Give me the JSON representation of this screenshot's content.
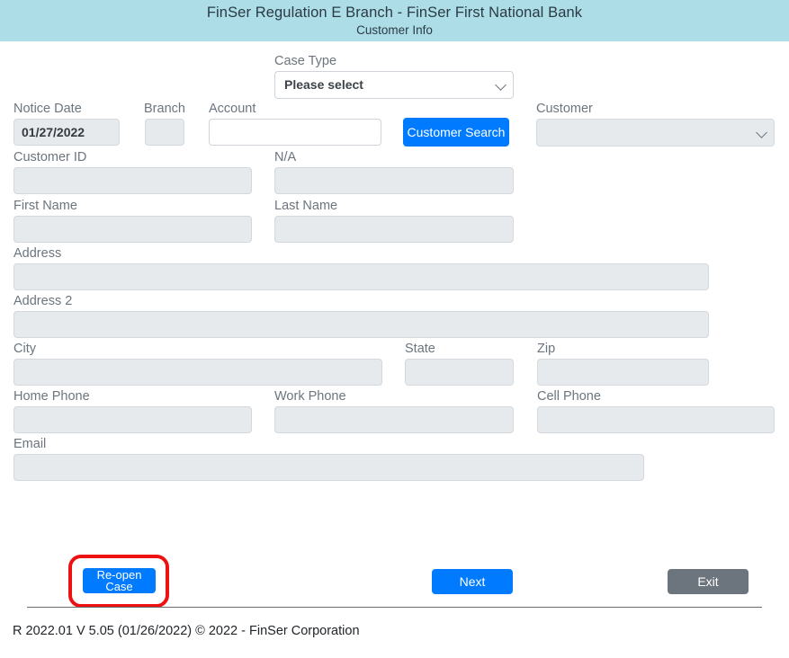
{
  "header": {
    "bank_title": "FinSer Regulation E Branch - FinSer First National Bank",
    "page_subtitle": "Customer Info",
    "background_color": "#addde6"
  },
  "colors": {
    "primary_button": "#007bff",
    "secondary_button": "#6c757d",
    "disabled_field": "#e6eaed",
    "annotation": "#ee1111",
    "label_text": "#6c757d"
  },
  "form": {
    "case_type": {
      "label": "Case Type",
      "value": "Please select",
      "options": [
        "Please select"
      ],
      "icon": "chevron-down-icon"
    },
    "notice_date": {
      "label": "Notice Date",
      "value": "01/27/2022",
      "placeholder": ""
    },
    "branch": {
      "label": "Branch",
      "value": "",
      "placeholder": ""
    },
    "account": {
      "label": "Account",
      "value": "",
      "placeholder": ""
    },
    "customer_search": {
      "label": "Customer Search"
    },
    "customer": {
      "label": "Customer",
      "value": "",
      "options": [],
      "icon": "chevron-down-icon"
    },
    "customer_id": {
      "label": "Customer ID",
      "value": "",
      "placeholder": ""
    },
    "na": {
      "label": "N/A",
      "value": "",
      "placeholder": ""
    },
    "first_name": {
      "label": "First Name",
      "value": "",
      "placeholder": ""
    },
    "last_name": {
      "label": "Last Name",
      "value": "",
      "placeholder": ""
    },
    "address": {
      "label": "Address",
      "value": "",
      "placeholder": ""
    },
    "address2": {
      "label": "Address 2",
      "value": "",
      "placeholder": ""
    },
    "city": {
      "label": "City",
      "value": "",
      "placeholder": ""
    },
    "state": {
      "label": "State",
      "value": "",
      "placeholder": ""
    },
    "zip": {
      "label": "Zip",
      "value": "",
      "placeholder": ""
    },
    "home_phone": {
      "label": "Home Phone",
      "value": "",
      "placeholder": ""
    },
    "work_phone": {
      "label": "Work Phone",
      "value": "",
      "placeholder": ""
    },
    "cell_phone": {
      "label": "Cell Phone",
      "value": "",
      "placeholder": ""
    },
    "email": {
      "label": "Email",
      "value": "",
      "placeholder": ""
    }
  },
  "actions": {
    "reopen_case": "Re-open Case",
    "next": "Next",
    "exit": "Exit"
  },
  "footer": {
    "text": "R 2022.01 V 5.05 (01/26/2022) © 2022 - FinSer Corporation"
  }
}
